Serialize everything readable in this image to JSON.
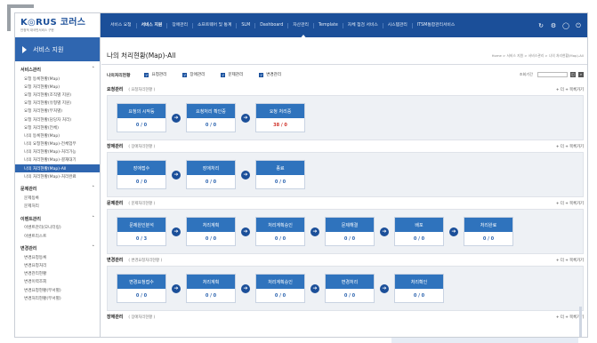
{
  "header": {
    "logo": "K◎RUS 코러스",
    "logo_sub": "안정적 대국민서비스 구현",
    "nav": [
      {
        "label": "서비스 요청",
        "active": false
      },
      {
        "label": "서비스 지원",
        "active": true
      },
      {
        "label": "장애관리",
        "active": false
      },
      {
        "label": "소프트웨어 및 통계",
        "active": false
      },
      {
        "label": "SLM",
        "active": false
      },
      {
        "label": "Dashboard",
        "active": false
      },
      {
        "label": "자산관리",
        "active": false
      },
      {
        "label": "Template",
        "active": false
      },
      {
        "label": "자체 점검 서비스",
        "active": false
      },
      {
        "label": "시스템관리",
        "active": false
      },
      {
        "label": "ITSM통합관리서비스",
        "active": false
      }
    ],
    "icons": [
      "refresh-icon",
      "gear-icon",
      "user-icon",
      "power-icon"
    ]
  },
  "sidebar": {
    "title": "서비스 지원",
    "groups": [
      {
        "title": "서비스관리",
        "items": [
          {
            "label": "요청 등록현황(Map)",
            "active": false
          },
          {
            "label": "요청 처리현황(Map)",
            "active": false
          },
          {
            "label": "요청 처리현황(조직별 지원)",
            "active": false
          },
          {
            "label": "요청 처리현황(유형별 지원)",
            "active": false
          },
          {
            "label": "요청 처리현황(부처별)",
            "active": false
          },
          {
            "label": "요청 처리현황(담당자 처리)",
            "active": false
          },
          {
            "label": "요청 처리현황(전체)",
            "active": false
          },
          {
            "label": "나의 등록현황(Map)",
            "active": false
          },
          {
            "label": "나의 요청현황(Map)-전체업무",
            "active": false
          },
          {
            "label": "나의 처리현황(Map)-처리가능",
            "active": false
          },
          {
            "label": "나의 처리현황(Map)-결재대기",
            "active": false
          },
          {
            "label": "나의 처리현황(Map)-All",
            "active": true
          },
          {
            "label": "나의 처리현황(Map)-처리완료",
            "active": false
          }
        ]
      },
      {
        "title": "문제관리",
        "items": [
          {
            "label": "문제등록",
            "active": false
          },
          {
            "label": "문제처리",
            "active": false
          }
        ]
      },
      {
        "title": "이벤트관리",
        "items": [
          {
            "label": "이벤트관리(모니터링)",
            "active": false
          },
          {
            "label": "이벤트리스트",
            "active": false
          }
        ]
      },
      {
        "title": "변경관리",
        "items": [
          {
            "label": "변경요청등록",
            "active": false
          },
          {
            "label": "변경요청처리",
            "active": false
          },
          {
            "label": "변경관리현황",
            "active": false
          },
          {
            "label": "변경이력조회",
            "active": false
          },
          {
            "label": "변경요청현황(부서별)",
            "active": false
          },
          {
            "label": "변경처리현황(부서별)",
            "active": false
          }
        ]
      }
    ]
  },
  "main": {
    "title": "나의 처리현황(Map)-All",
    "breadcrumb": "Home > 서비스 지원 > 서비스관리 > 나의 처리현황(Map)-All",
    "filter": {
      "label": "나의처리현황",
      "checks": [
        "요청관리",
        "장애관리",
        "문제관리",
        "변경관리"
      ],
      "right_label": "조회기간"
    },
    "sections": [
      {
        "title": "요청관리",
        "sub": "( 요청처리현황 )",
        "more": "+ 더 + 목록가기",
        "boxes": [
          {
            "label": "요청의 시작등",
            "value": "0 / 0",
            "alert": false
          },
          {
            "label": "요청처리 확인중",
            "value": "0 / 0",
            "alert": false
          },
          {
            "label": "요청 처리중",
            "value": "38 / 0",
            "alert": true
          }
        ]
      },
      {
        "title": "장애관리",
        "sub": "( 장애처리현황 )",
        "more": "+ 더 + 목록가기",
        "boxes": [
          {
            "label": "장애접수",
            "value": "0 / 0",
            "alert": false
          },
          {
            "label": "장애처리",
            "value": "0 / 0",
            "alert": false
          },
          {
            "label": "종료",
            "value": "0 / 0",
            "alert": false
          }
        ]
      },
      {
        "title": "문제관리",
        "sub": "( 문제처리현황 )",
        "more": "+ 더 + 목록가기",
        "boxes": [
          {
            "label": "문제원인분석",
            "value": "0 / 3",
            "alert": false
          },
          {
            "label": "처리계획",
            "value": "0 / 0",
            "alert": false
          },
          {
            "label": "처리계획승인",
            "value": "0 / 0",
            "alert": false
          },
          {
            "label": "문제해결",
            "value": "0 / 0",
            "alert": false
          },
          {
            "label": "배포",
            "value": "0 / 0",
            "alert": false
          },
          {
            "label": "처리완료",
            "value": "0 / 0",
            "alert": false
          }
        ]
      },
      {
        "title": "변경관리",
        "sub": "( 변경요청처리현황 )",
        "more": "+ 더 + 목록가기",
        "boxes": [
          {
            "label": "변경요청접수",
            "value": "0 / 0",
            "alert": false
          },
          {
            "label": "처리계획",
            "value": "0 / 0",
            "alert": false
          },
          {
            "label": "처리계획승인",
            "value": "0 / 0",
            "alert": false
          },
          {
            "label": "변경처리",
            "value": "0 / 0",
            "alert": false
          },
          {
            "label": "처리확인",
            "value": "0 / 0",
            "alert": false
          }
        ]
      },
      {
        "title": "장애관리",
        "sub": "( 장애처리현황 )",
        "more": "+ 더 + 목록가기",
        "boxes": []
      }
    ]
  }
}
